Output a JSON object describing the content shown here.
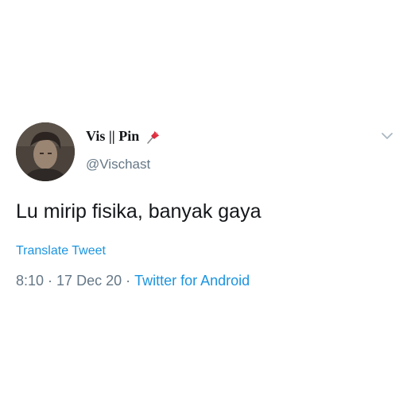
{
  "tweet": {
    "display_name": "Vis || Pin",
    "pin_icon": "pushpin-icon",
    "handle": "@Vischast",
    "text": "Lu mirip fisika, banyak gaya",
    "translate_label": "Translate Tweet",
    "time": "8:10",
    "date": "17 Dec 20",
    "separator": "·",
    "source": "Twitter for Android",
    "menu_icon": "chevron-down-icon"
  },
  "colors": {
    "link": "#1b95e0",
    "secondary_text": "#657786",
    "primary_text": "#14171a",
    "pin": "#d6213c"
  }
}
